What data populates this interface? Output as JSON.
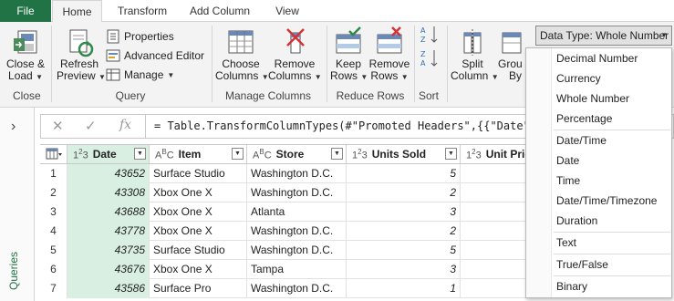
{
  "tabs": {
    "file": "File",
    "home": "Home",
    "transform": "Transform",
    "add_column": "Add Column",
    "view": "View"
  },
  "ribbon": {
    "close_load": [
      "Close &",
      "Load"
    ],
    "refresh_preview": [
      "Refresh",
      "Preview"
    ],
    "properties": "Properties",
    "advanced_editor": "Advanced Editor",
    "manage": "Manage",
    "choose_columns": [
      "Choose",
      "Columns"
    ],
    "remove_columns": [
      "Remove",
      "Columns"
    ],
    "keep_rows": [
      "Keep",
      "Rows"
    ],
    "remove_rows": [
      "Remove",
      "Rows"
    ],
    "split_column": [
      "Split",
      "Column"
    ],
    "group_by": [
      "Grou",
      "By"
    ],
    "groups": {
      "close": "Close",
      "query": "Query",
      "manage_columns": "Manage Columns",
      "reduce_rows": "Reduce Rows",
      "sort": "Sort"
    },
    "data_type_button": "Data Type: Whole Number"
  },
  "queries_pane": {
    "label": "Queries"
  },
  "formula_bar": {
    "fx": "fx",
    "formula": "= Table.TransformColumnTypes(#\"Promoted Headers\",{{\"Date\", Int"
  },
  "grid": {
    "columns": [
      {
        "name": "Date",
        "type": "whole-number"
      },
      {
        "name": "Item",
        "type": "text"
      },
      {
        "name": "Store",
        "type": "text"
      },
      {
        "name": "Units Sold",
        "type": "whole-number"
      },
      {
        "name": "Unit Price",
        "type": "whole-number"
      }
    ],
    "rows": [
      {
        "n": "1",
        "date": "43652",
        "item": "Surface Studio",
        "store": "Washington D.C.",
        "units": "5"
      },
      {
        "n": "2",
        "date": "43308",
        "item": "Xbox One X",
        "store": "Washington D.C.",
        "units": "2"
      },
      {
        "n": "3",
        "date": "43688",
        "item": "Xbox One X",
        "store": "Atlanta",
        "units": "3"
      },
      {
        "n": "4",
        "date": "43778",
        "item": "Xbox One X",
        "store": "Washington D.C.",
        "units": "2"
      },
      {
        "n": "5",
        "date": "43735",
        "item": "Surface Studio",
        "store": "Washington D.C.",
        "units": "5"
      },
      {
        "n": "6",
        "date": "43676",
        "item": "Xbox One X",
        "store": "Tampa",
        "units": "3"
      },
      {
        "n": "7",
        "date": "43586",
        "item": "Surface Pro",
        "store": "Washington D.C.",
        "units": "1"
      }
    ]
  },
  "data_type_menu": {
    "items": [
      "Decimal Number",
      "Currency",
      "Whole Number",
      "Percentage",
      "Date/Time",
      "Date",
      "Time",
      "Date/Time/Timezone",
      "Duration",
      "Text",
      "True/False",
      "Binary"
    ]
  },
  "colors": {
    "accent": "#217346",
    "selected_column": "#d9efe1",
    "ribbon_bg": "#f3f3f3"
  },
  "icons": [
    "table-icon",
    "fx-icon",
    "cancel-icon",
    "check-icon",
    "chevron-right-icon",
    "filter-dropdown-icon",
    "sort-asc-icon",
    "sort-desc-icon"
  ]
}
